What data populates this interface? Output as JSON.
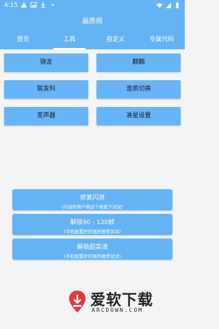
{
  "status_bar": {
    "time": "4:15",
    "left_icons": [
      "warning-icon",
      "image-icon",
      "download-icon",
      "dot-icon"
    ],
    "right_icons": [
      "wifi-icon",
      "signal-icon",
      "battery-icon"
    ]
  },
  "app": {
    "title": "画质阁"
  },
  "tabs": [
    {
      "label": "首页",
      "active": false
    },
    {
      "label": "工具",
      "active": true
    },
    {
      "label": "自定义",
      "active": false
    },
    {
      "label": "专属代码",
      "active": false
    }
  ],
  "grid_buttons": [
    "骁龙",
    "麒麟",
    "联发科",
    "音质切换",
    "变声器",
    "准星设置"
  ],
  "action_buttons": [
    {
      "title": "修复闪退",
      "subtitle": "(闪退的用户用这个修复下试试)"
    },
    {
      "title": "解锁90 - 120帧",
      "subtitle": "(手机配置好的强烈推荐试试)"
    },
    {
      "title": "解锁超高清",
      "subtitle": "(手机配置好的强烈推荐试试)"
    }
  ],
  "watermark": {
    "text": "爱软下载",
    "sub": "ARCDOWN.COM"
  },
  "colors": {
    "header": "#64b4f5",
    "button": "#66b5f6",
    "background": "#f4f4f4"
  }
}
